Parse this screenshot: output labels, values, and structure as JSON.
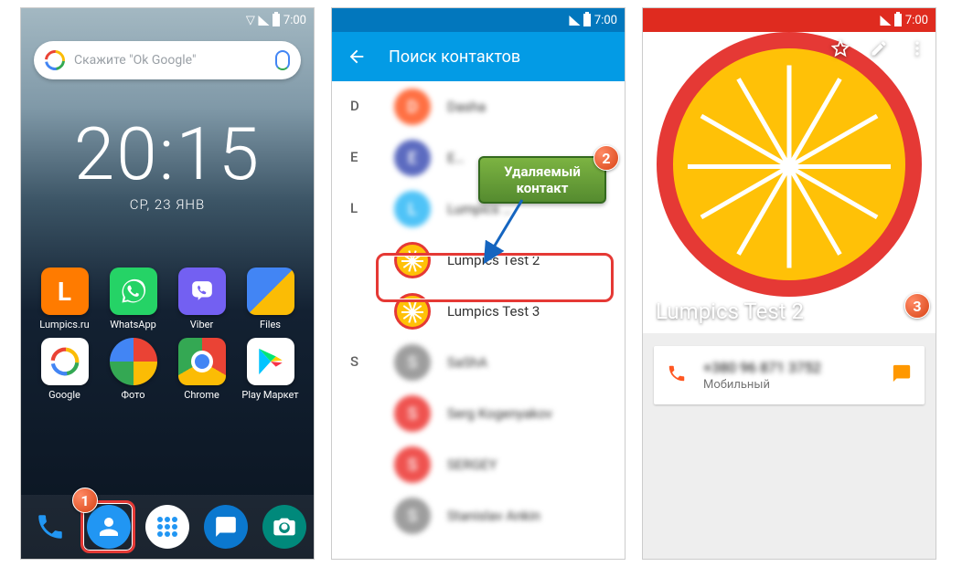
{
  "status_time": "7:00",
  "home": {
    "search_placeholder": "Скажите \"Ok Google\"",
    "time": "20:15",
    "date": "СР, 23 ЯНВ",
    "apps": [
      {
        "label": "Lumpics.ru"
      },
      {
        "label": "WhatsApp"
      },
      {
        "label": "Viber"
      },
      {
        "label": "Files"
      },
      {
        "label": "Google"
      },
      {
        "label": "Фото"
      },
      {
        "label": "Chrome"
      },
      {
        "label": "Play Маркет"
      }
    ]
  },
  "list": {
    "search_label": "Поиск контактов",
    "sections": {
      "D": [
        {
          "name": "Dasha",
          "color": "#ff7043",
          "initial": "D"
        }
      ],
      "E": [
        {
          "name": "E…",
          "color": "#5c6bc0",
          "initial": "E"
        }
      ],
      "L": [
        {
          "name": "Lumpics …",
          "color": "#4fc3f7",
          "initial": "L"
        },
        {
          "name": "Lumpics Test 2",
          "lemon": true,
          "sharp": true
        },
        {
          "name": "Lumpics Test 3",
          "lemon": true,
          "sharp": true
        }
      ],
      "S": [
        {
          "name": "SaShA",
          "color": "#9e9e9e",
          "initial": "S"
        },
        {
          "name": "Serg Kogenyakov",
          "color": "#ef5350",
          "initial": "S"
        },
        {
          "name": "SERGEY",
          "color": "#ef5350",
          "initial": "S"
        },
        {
          "name": "Stanislav Ankin",
          "color": "#9e9e9e",
          "initial": "S"
        }
      ]
    },
    "callout": "Удаляемый контакт"
  },
  "detail": {
    "name": "Lumpics Test 2",
    "phone_masked": "+380 96 871 3752",
    "phone_type": "Мобильный"
  },
  "badges": {
    "b1": "1",
    "b2": "2",
    "b3": "3"
  }
}
